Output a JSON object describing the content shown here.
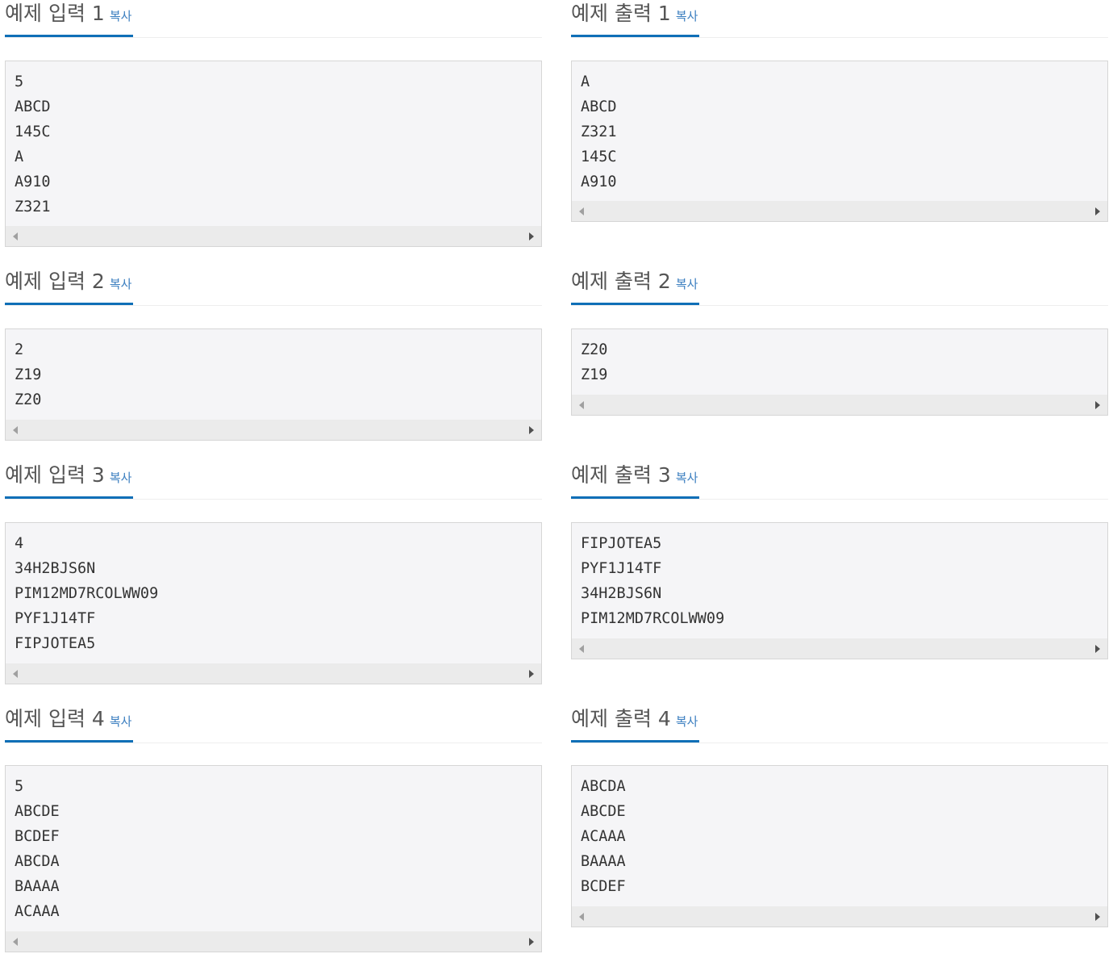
{
  "copy_label": "복사",
  "samples": [
    {
      "input_title": "예제 입력 1",
      "input_lines": "5\nABCD\n145C\nA\nA910\nZ321",
      "output_title": "예제 출력 1",
      "output_lines": "A\nABCD\nZ321\n145C\nA910"
    },
    {
      "input_title": "예제 입력 2",
      "input_lines": "2\nZ19\nZ20",
      "output_title": "예제 출력 2",
      "output_lines": "Z20\nZ19"
    },
    {
      "input_title": "예제 입력 3",
      "input_lines": "4\n34H2BJS6N\nPIM12MD7RCOLWW09\nPYF1J14TF\nFIPJOTEA5",
      "output_title": "예제 출력 3",
      "output_lines": "FIPJOTEA5\nPYF1J14TF\n34H2BJS6N\nPIM12MD7RCOLWW09"
    },
    {
      "input_title": "예제 입력 4",
      "input_lines": "5\nABCDE\nBCDEF\nABCDA\nBAAAA\nACAAA",
      "output_title": "예제 출력 4",
      "output_lines": "ABCDA\nABCDE\nACAAA\nBAAAA\nBCDEF"
    }
  ]
}
